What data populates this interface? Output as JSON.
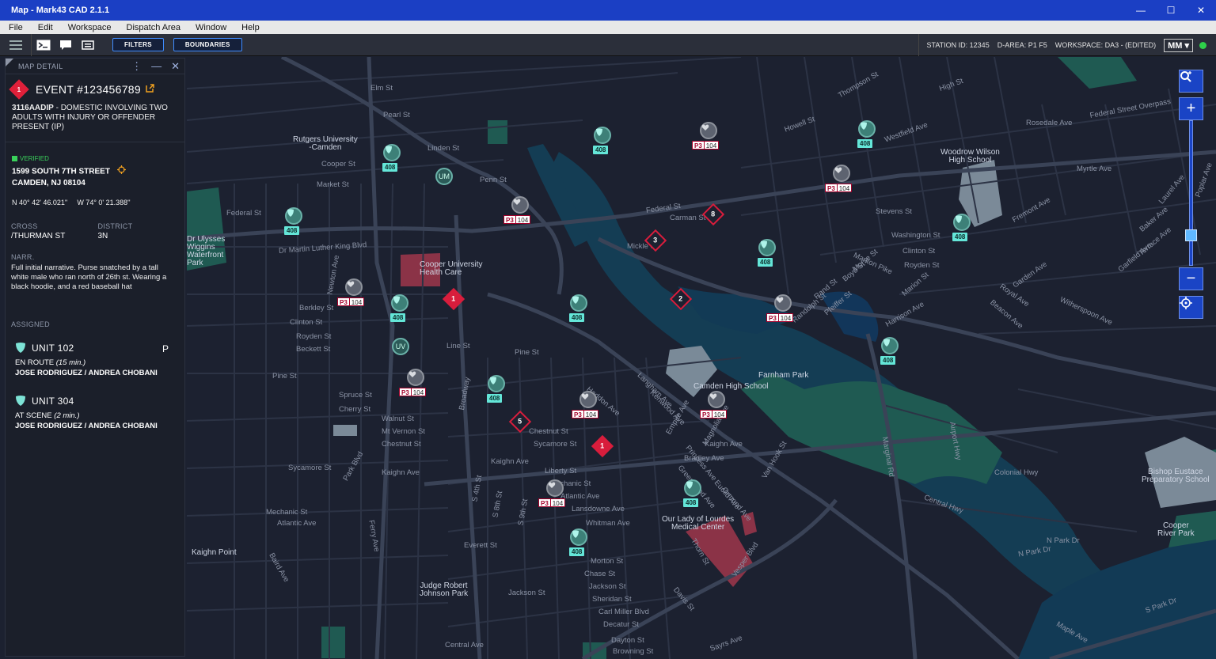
{
  "window": {
    "title": "Map - Mark43 CAD 2.1.1",
    "min": "—",
    "max": "☐",
    "close": "✕"
  },
  "menu": [
    "File",
    "Edit",
    "Workspace",
    "Dispatch Area",
    "Window",
    "Help"
  ],
  "toolbar": {
    "filters_label": "FILTERS",
    "boundaries_label": "BOUNDARIES",
    "station": "STATION ID: 12345",
    "darea": "D-AREA: P1 F5",
    "workspace": "WORKSPACE: DA3 - (EDITED)",
    "user": "MM ▾",
    "status_color": "#2ed14a"
  },
  "panel": {
    "title": "MAP DETAIL",
    "event": {
      "badge": "1",
      "title": "EVENT #123456789",
      "code": "3116AADIP",
      "description": " - DOMESTIC INVOLVING TWO ADULTS WITH INJURY OR OFFENDER PRESENT (IP)",
      "verified": "VERIFIED",
      "address_line1": "1599 SOUTH 7TH STREET",
      "address_line2": "CAMDEN, NJ 08104",
      "lat": "N 40° 42' 46.021''",
      "lon": "W 74° 0' 21.388''",
      "cross_label": "CROSS",
      "cross_value": "/THURMAN ST",
      "district_label": "DISTRICT",
      "district_value": "3N",
      "narr_label": "NARR.",
      "narr_value": "Full initial narrative. Purse snatched by a tall white male who ran north of 26th st. Wearing a black hoodie, and a red baseball hat"
    },
    "assigned_label": "ASSIGNED",
    "units": [
      {
        "name": "UNIT 102",
        "flag": "P",
        "status": "EN ROUTE",
        "eta": "(15 min.)",
        "crew": "JOSE RODRIGUEZ / ANDREA CHOBANI"
      },
      {
        "name": "UNIT 304",
        "flag": "",
        "status": "AT SCENE",
        "eta": "(2 min.)",
        "crew": "JOSE RODRIGUEZ / ANDREA CHOBANI"
      }
    ]
  },
  "map": {
    "labels": [
      {
        "t": "Rutgers University\n-Camden",
        "poi": true
      },
      {
        "t": "Cooper University\nHealth Care",
        "poi": true
      },
      {
        "t": "Dr Ulysses\nWiggins\nWaterfront\nPark",
        "poi": true
      },
      {
        "t": "Woodrow Wilson\nHigh School",
        "poi": true
      },
      {
        "t": "Farnham Park",
        "poi": true
      },
      {
        "t": "Camden High School",
        "poi": true
      },
      {
        "t": "Our Lady of Lourdes\nMedical Center",
        "poi": true
      },
      {
        "t": "Bishop Eustace\nPreparatory School",
        "poi": true
      },
      {
        "t": "Cooper\nRiver Park",
        "poi": true
      },
      {
        "t": "Judge Robert\nJohnson Park",
        "poi": true
      },
      {
        "t": "Kaighn Point",
        "poi": true
      },
      {
        "t": "Federal St"
      },
      {
        "t": "Dr Martin Luther King Blvd"
      },
      {
        "t": "Clinton St"
      },
      {
        "t": "Royden St"
      },
      {
        "t": "Beckett St"
      },
      {
        "t": "Berkley St"
      },
      {
        "t": "Pine St"
      },
      {
        "t": "Spruce St"
      },
      {
        "t": "Cherry St"
      },
      {
        "t": "Walnut St"
      },
      {
        "t": "Mt Vernon St"
      },
      {
        "t": "Chestnut St"
      },
      {
        "t": "Sycamore St"
      },
      {
        "t": "Mechanic St"
      },
      {
        "t": "Atlantic Ave"
      },
      {
        "t": "Kaighn Ave"
      },
      {
        "t": "Line St"
      },
      {
        "t": "Pine St"
      },
      {
        "t": "Chestnut St"
      },
      {
        "t": "Sycamore St"
      },
      {
        "t": "Kaighn Ave"
      },
      {
        "t": "Liberty St"
      },
      {
        "t": "Mechanic St"
      },
      {
        "t": "Atlantic Ave"
      },
      {
        "t": "Lansdowne Ave"
      },
      {
        "t": "Whitman Ave"
      },
      {
        "t": "Morton St"
      },
      {
        "t": "Chase St"
      },
      {
        "t": "Jackson St"
      },
      {
        "t": "Sheridan St"
      },
      {
        "t": "Carl Miller Blvd"
      },
      {
        "t": "Decatur St"
      },
      {
        "t": "Dayton St"
      },
      {
        "t": "Browning St"
      },
      {
        "t": "Central Ave"
      },
      {
        "t": "Everett St"
      },
      {
        "t": "Jackson St"
      },
      {
        "t": "Bradley Ave"
      },
      {
        "t": "Kaighn Ave"
      },
      {
        "t": "Carman St"
      },
      {
        "t": "Mickle St"
      },
      {
        "t": "Stevens St"
      },
      {
        "t": "Washington St"
      },
      {
        "t": "Clinton St"
      },
      {
        "t": "Royden St"
      },
      {
        "t": "Marlton Pike"
      },
      {
        "t": "Colonial Hwy"
      },
      {
        "t": "Central Hwy"
      },
      {
        "t": "N Park Dr"
      },
      {
        "t": "Federal St"
      },
      {
        "t": "Myrtle Ave"
      },
      {
        "t": "Rosedale Ave"
      },
      {
        "t": "Elm St"
      },
      {
        "t": "Pearl St"
      },
      {
        "t": "Linden St"
      },
      {
        "t": "Penn St"
      },
      {
        "t": "Market St"
      },
      {
        "t": "Cooper St"
      },
      {
        "t": "Howell St"
      },
      {
        "t": "High St"
      },
      {
        "t": "Thompson St"
      },
      {
        "t": "Federal Street Overpass"
      },
      {
        "t": "Westfield Ave"
      },
      {
        "t": "Haddon Ave"
      },
      {
        "t": "Vesper Blvd"
      },
      {
        "t": "Thorn St"
      },
      {
        "t": "Davis St"
      },
      {
        "t": "Sayrs Ave"
      },
      {
        "t": "Witherspoon Ave"
      },
      {
        "t": "Beacon Ave"
      },
      {
        "t": "Royal Ave"
      },
      {
        "t": "Garden Ave"
      },
      {
        "t": "Baker Ave"
      },
      {
        "t": "Terrace Ave"
      },
      {
        "t": "Laurel Ave"
      },
      {
        "t": "Garfield Ave"
      },
      {
        "t": "Poplar Ave"
      },
      {
        "t": "Airport Hwy"
      },
      {
        "t": "Marginal Rd"
      },
      {
        "t": "N Park Dr"
      },
      {
        "t": "S Park Dr"
      },
      {
        "t": "Maple Ave"
      },
      {
        "t": "Fremont Ave"
      },
      {
        "t": "Harrison Ave"
      },
      {
        "t": "Rand St"
      },
      {
        "t": "Pfeiffer St"
      },
      {
        "t": "Randolph St"
      },
      {
        "t": "Boyd St"
      },
      {
        "t": "Morse St"
      },
      {
        "t": "Marion St"
      },
      {
        "t": "Van Hook St"
      },
      {
        "t": "Euclid Ave"
      },
      {
        "t": "Ormond Ave"
      },
      {
        "t": "Greenwood Ave"
      },
      {
        "t": "Princess Ave"
      },
      {
        "t": "Kenwood Ave"
      },
      {
        "t": "Langham Ave"
      },
      {
        "t": "Empire Ave"
      },
      {
        "t": "Magnolia Ave"
      },
      {
        "t": "Baird Ave"
      },
      {
        "t": "Park Blvd"
      },
      {
        "t": "Ferry Ave"
      },
      {
        "t": "Newton Ave"
      },
      {
        "t": "Broadway"
      },
      {
        "t": "S 4th St"
      },
      {
        "t": "S 8th St"
      },
      {
        "t": "S 9th St"
      },
      {
        "t": "S 10th St"
      }
    ],
    "units": [
      {
        "kind": "teal",
        "n": "408"
      },
      {
        "kind": "teal",
        "n": "408"
      },
      {
        "kind": "teal",
        "n": "408"
      },
      {
        "kind": "teal",
        "n": "408"
      },
      {
        "kind": "teal",
        "n": "408"
      },
      {
        "kind": "teal",
        "n": "408"
      },
      {
        "kind": "teal",
        "n": "408"
      },
      {
        "kind": "teal",
        "n": "408"
      },
      {
        "kind": "teal",
        "n": "408"
      },
      {
        "kind": "teal",
        "n": "408"
      },
      {
        "kind": "teal",
        "n": "408"
      },
      {
        "kind": "teal",
        "n": "408"
      },
      {
        "kind": "gray",
        "p": "P3",
        "n": "104"
      },
      {
        "kind": "gray",
        "p": "P3",
        "n": "104"
      },
      {
        "kind": "gray",
        "p": "P3",
        "n": "104"
      },
      {
        "kind": "gray",
        "p": "P3",
        "n": "104"
      },
      {
        "kind": "gray",
        "p": "P3",
        "n": "104"
      },
      {
        "kind": "gray",
        "p": "P3",
        "n": "104"
      },
      {
        "kind": "gray",
        "p": "P3",
        "n": "104"
      },
      {
        "kind": "gray",
        "p": "P3",
        "n": "104"
      },
      {
        "kind": "gray",
        "p": "P3",
        "n": "104"
      }
    ],
    "events": [
      {
        "n": "1",
        "style": "red"
      },
      {
        "n": "1",
        "style": "red"
      },
      {
        "n": "2",
        "style": "outline"
      },
      {
        "n": "3",
        "style": "outline"
      },
      {
        "n": "5",
        "style": "outline"
      },
      {
        "n": "8",
        "style": "outline"
      }
    ],
    "rings": [
      "UM",
      "UV"
    ]
  },
  "colors": {
    "accent": "#1a44c5",
    "event": "#d81d3c",
    "teal_unit": "#64e6d8",
    "verified": "#39d15a"
  }
}
